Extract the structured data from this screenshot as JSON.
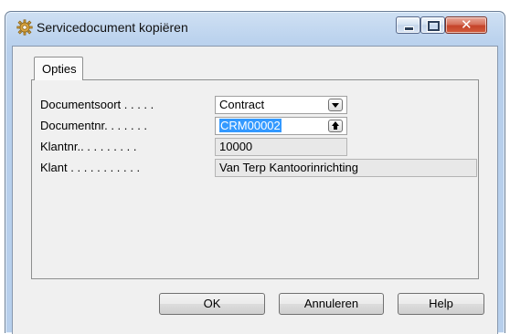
{
  "window": {
    "title": "Servicedocument kopiëren",
    "app_icon": "gear-icon",
    "controls": {
      "minimize": "minimize-icon",
      "maximize": "maximize-icon",
      "close": "close-icon"
    }
  },
  "tabs": [
    {
      "label": "Opties",
      "selected": true
    }
  ],
  "fields": [
    {
      "label": "Documentsoort . . . . .",
      "value": "Contract",
      "type": "dropdown"
    },
    {
      "label": "Documentnr. . . . . . .",
      "value": "CRM00002",
      "type": "lookup",
      "selected": true
    },
    {
      "label": "Klantnr.. . . . . . . . .",
      "value": "10000",
      "type": "readonly"
    },
    {
      "label": "Klant . . . . . . . . . . .",
      "value": "Van Terp Kantoorinrichting",
      "type": "readonly"
    }
  ],
  "buttons": {
    "ok": "OK",
    "cancel": "Annuleren",
    "help": "Help"
  },
  "colors": {
    "selection": "#3399ff",
    "close_button": "#c5432a"
  }
}
